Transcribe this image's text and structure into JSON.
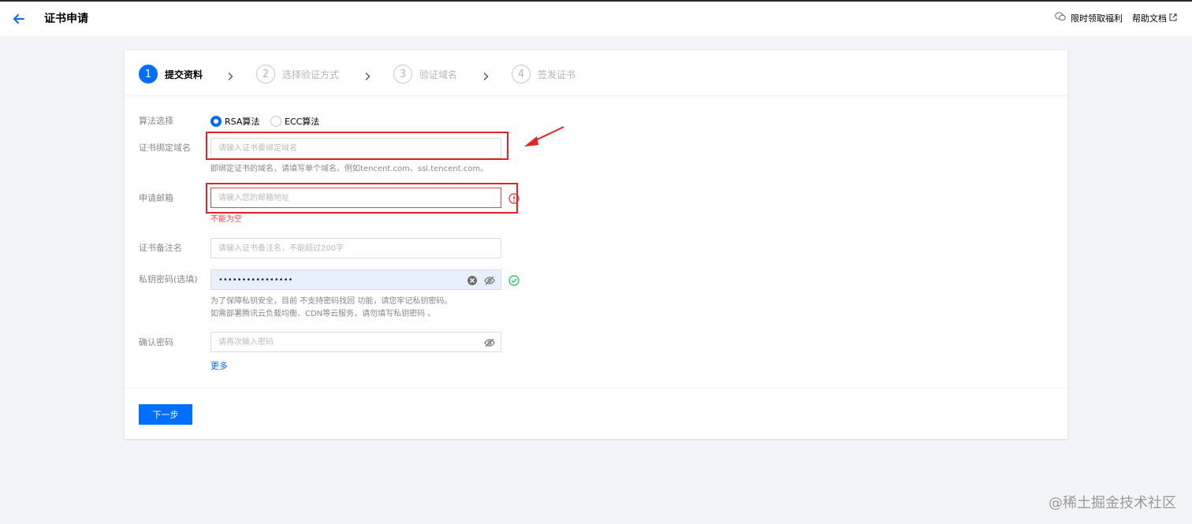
{
  "header": {
    "title": "证书申请",
    "promo_label": "限时领取福利",
    "help_label": "帮助文档"
  },
  "steps": [
    {
      "num": "1",
      "label": "提交资料",
      "active": true
    },
    {
      "num": "2",
      "label": "选择验证方式",
      "active": false
    },
    {
      "num": "3",
      "label": "验证域名",
      "active": false
    },
    {
      "num": "4",
      "label": "签发证书",
      "active": false
    }
  ],
  "form": {
    "algorithm": {
      "label": "算法选择",
      "options": [
        "RSA算法",
        "ECC算法"
      ],
      "selected": "RSA算法"
    },
    "domain": {
      "label": "证书绑定域名",
      "placeholder": "请输入证书要绑定域名",
      "help": "即绑定证书的域名，请填写单个域名。例如tencent.com、ssl.tencent.com。"
    },
    "email": {
      "label": "申请邮箱",
      "placeholder": "请输入您的邮箱地址",
      "error": "不能为空"
    },
    "remark": {
      "label": "证书备注名",
      "placeholder": "请输入证书备注名，不能超过200字"
    },
    "private_key": {
      "label": "私钥密码(选填)",
      "value": "••••••••••••••••",
      "help_line1": "为了保障私钥安全，目前 不支持密码找回 功能，请您牢记私钥密码。",
      "help_line2": "如需部署腾讯云负载均衡、CDN等云服务，请勿填写私钥密码 。"
    },
    "confirm": {
      "label": "确认密码",
      "placeholder": "请再次输入密码"
    },
    "more_label": "更多",
    "next_label": "下一步"
  },
  "colors": {
    "primary": "#006eff",
    "error": "#e54545",
    "success": "#29cc6a",
    "annotation": "#e62222"
  },
  "watermark": "@稀土掘金技术社区"
}
